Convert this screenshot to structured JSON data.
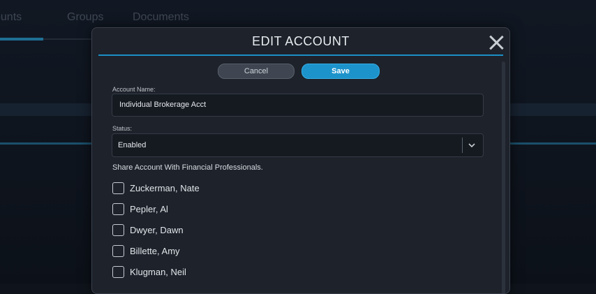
{
  "background": {
    "tabs": [
      "ounts",
      "Groups",
      "Documents"
    ]
  },
  "modal": {
    "title": "EDIT ACCOUNT",
    "cancel_label": "Cancel",
    "save_label": "Save",
    "account_name_label": "Account Name:",
    "account_name_value": "Individual Brokerage Acct",
    "status_label": "Status:",
    "status_value": "Enabled",
    "share_heading": "Share Account With Financial Professionals.",
    "professionals": [
      {
        "name": "Zuckerman, Nate",
        "checked": false
      },
      {
        "name": "Pepler, Al",
        "checked": false
      },
      {
        "name": "Dwyer, Dawn",
        "checked": false
      },
      {
        "name": "Billette, Amy",
        "checked": false
      },
      {
        "name": "Klugman, Neil",
        "checked": false
      }
    ]
  },
  "colors": {
    "accent": "#1d93cc",
    "modal_bg": "#1d222b",
    "field_bg": "#151a21"
  },
  "icons": {
    "close": "close-icon",
    "dropdown": "chevron-down-icon"
  }
}
